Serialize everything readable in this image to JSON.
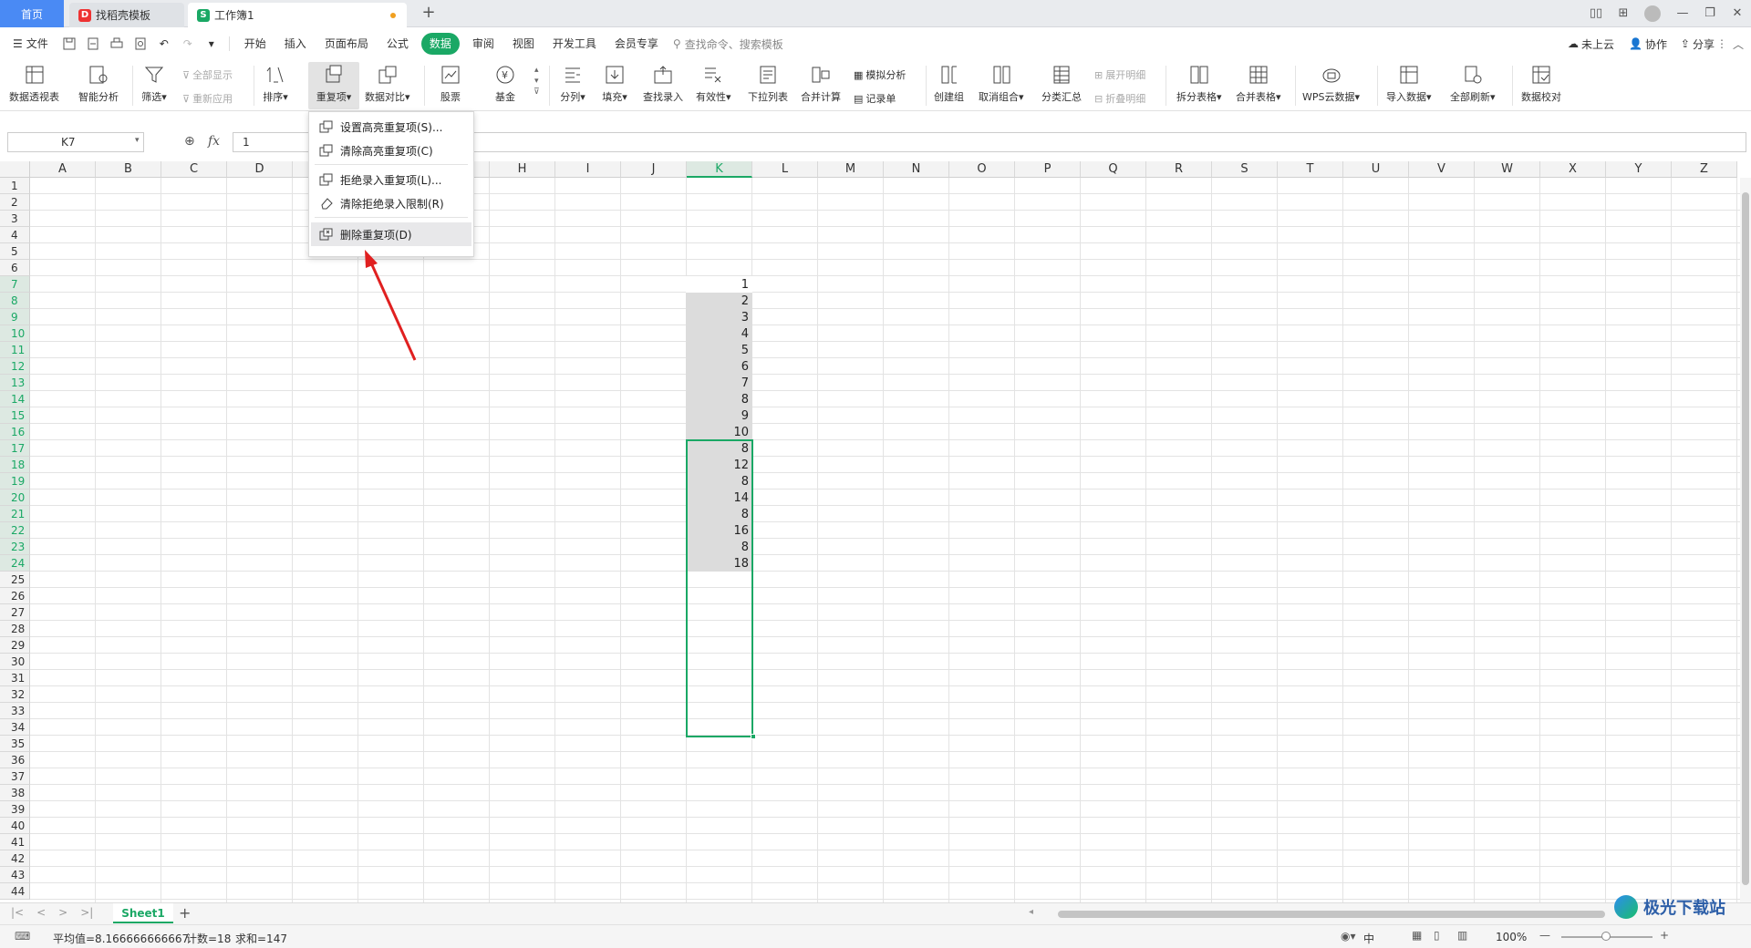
{
  "tabs": {
    "home": "首页",
    "docer": "找稻壳模板",
    "workbook": "工作簿1",
    "new": "+"
  },
  "menu": {
    "file": "文件",
    "items": [
      "开始",
      "插入",
      "页面布局",
      "公式",
      "数据",
      "审阅",
      "视图",
      "开发工具",
      "会员专享"
    ],
    "search_placeholder": "查找命令、搜索模板",
    "cloud": "未上云",
    "collab": "协作",
    "share": "分享"
  },
  "ribbon": {
    "pivot": "数据透视表",
    "smart": "智能分析",
    "filter": "筛选",
    "show_all": "全部显示",
    "reapply": "重新应用",
    "sort": "排序",
    "duplicates": "重复项",
    "compare": "数据对比",
    "stock": "股票",
    "fund": "基金",
    "split": "分列",
    "fill": "填充",
    "lookup": "查找录入",
    "validity": "有效性",
    "dropdown": "下拉列表",
    "consolidate": "合并计算",
    "whatif": "模拟分析",
    "record": "记录单",
    "group": "创建组",
    "ungroup": "取消组合",
    "subtotal": "分类汇总",
    "expand": "展开明细",
    "collapse": "折叠明细",
    "split_table": "拆分表格",
    "merge_table": "合并表格",
    "wps_cloud": "WPS云数据",
    "import": "导入数据",
    "refresh_all": "全部刷新",
    "verify": "数据校对"
  },
  "formula": {
    "cell_ref": "K7",
    "fx": "fx",
    "value": "1"
  },
  "columns": [
    "A",
    "B",
    "C",
    "D",
    "E",
    "F",
    "G",
    "H",
    "I",
    "J",
    "K",
    "L",
    "M",
    "N",
    "O",
    "P",
    "Q",
    "R",
    "S",
    "T",
    "U",
    "V",
    "W",
    "X",
    "Y",
    "Z"
  ],
  "rows": [
    "1",
    "2",
    "3",
    "4",
    "5",
    "6",
    "7",
    "8",
    "9",
    "10",
    "11",
    "12",
    "13",
    "14",
    "15",
    "16",
    "17",
    "18",
    "19",
    "20",
    "21",
    "22",
    "23",
    "24",
    "25",
    "26",
    "27",
    "28",
    "29",
    "30",
    "31",
    "32",
    "33",
    "34",
    "35",
    "36",
    "37",
    "38",
    "39",
    "40",
    "41",
    "42",
    "43",
    "44"
  ],
  "cells": [
    "1",
    "2",
    "3",
    "4",
    "5",
    "6",
    "7",
    "8",
    "9",
    "10",
    "8",
    "12",
    "8",
    "14",
    "8",
    "16",
    "8",
    "18"
  ],
  "dropdown": {
    "set_highlight": "设置高亮重复项(S)...",
    "clear_highlight": "清除高亮重复项(C)",
    "reject_input": "拒绝录入重复项(L)...",
    "clear_reject": "清除拒绝录入限制(R)",
    "delete_dup": "删除重复项(D)"
  },
  "sheet": {
    "name": "Sheet1"
  },
  "status": {
    "average": "平均值=8.166666666667",
    "count": "计数=18",
    "sum": "求和=147",
    "ime": "中",
    "zoom": "100%"
  },
  "watermark": "极光下载站",
  "colors": {
    "accent": "#1aa865",
    "tab_blue": "#4a8af4",
    "arrow": "#e02020"
  }
}
